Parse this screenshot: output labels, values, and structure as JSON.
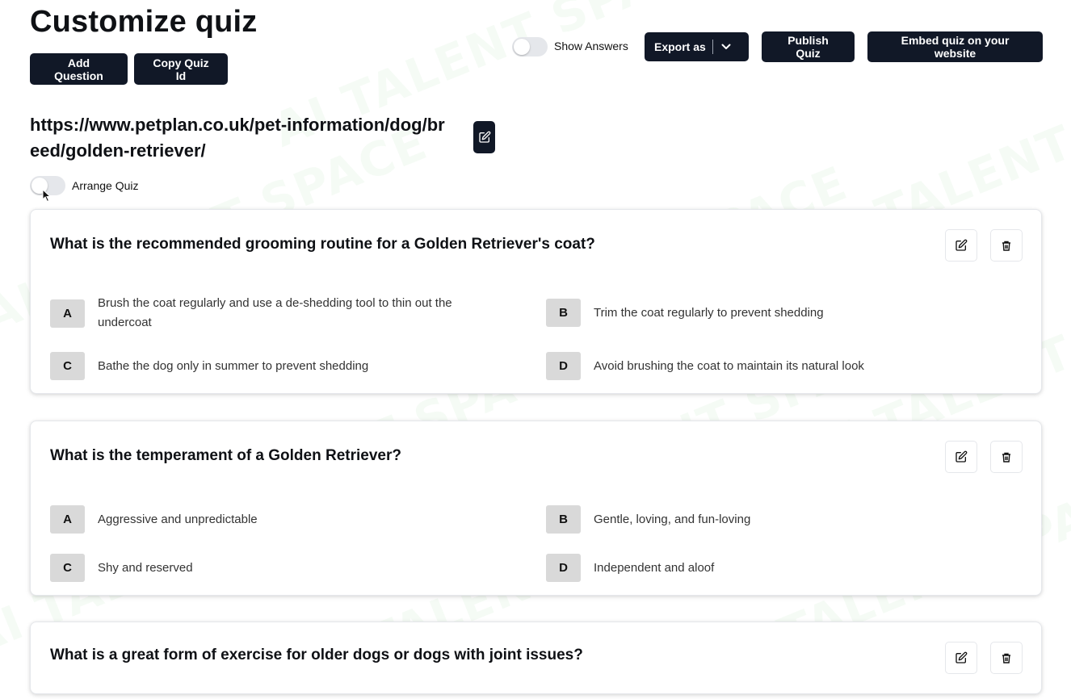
{
  "page": {
    "title": "Customize quiz",
    "watermark": "AI TALENT SPACE"
  },
  "toolbar": {
    "add_question": "Add Question",
    "copy_quiz_id": "Copy Quiz Id",
    "show_answers_label": "Show Answers",
    "show_answers_on": false,
    "export_label": "Export as",
    "publish_label": "Publish Quiz",
    "embed_label": "Embed quiz on your website"
  },
  "source": {
    "url": "https://www.petplan.co.uk/pet-information/dog/breed/golden-retriever/"
  },
  "arrange": {
    "label": "Arrange Quiz",
    "on": false
  },
  "questions": [
    {
      "text": "What is the recommended grooming routine for a Golden Retriever's coat?",
      "options": [
        {
          "letter": "A",
          "text": "Brush the coat regularly and use a de-shedding tool to thin out the undercoat"
        },
        {
          "letter": "B",
          "text": "Trim the coat regularly to prevent shedding"
        },
        {
          "letter": "C",
          "text": "Bathe the dog only in summer to prevent shedding"
        },
        {
          "letter": "D",
          "text": "Avoid brushing the coat to maintain its natural look"
        }
      ]
    },
    {
      "text": "What is the temperament of a Golden Retriever?",
      "options": [
        {
          "letter": "A",
          "text": "Aggressive and unpredictable"
        },
        {
          "letter": "B",
          "text": "Gentle, loving, and fun-loving"
        },
        {
          "letter": "C",
          "text": "Shy and reserved"
        },
        {
          "letter": "D",
          "text": "Independent and aloof"
        }
      ]
    },
    {
      "text": "What is a great form of exercise for older dogs or dogs with joint issues?"
    }
  ],
  "colors": {
    "primary": "#111827",
    "letter_badge": "#d9d9d9",
    "toggle_off": "#e5e7eb"
  }
}
